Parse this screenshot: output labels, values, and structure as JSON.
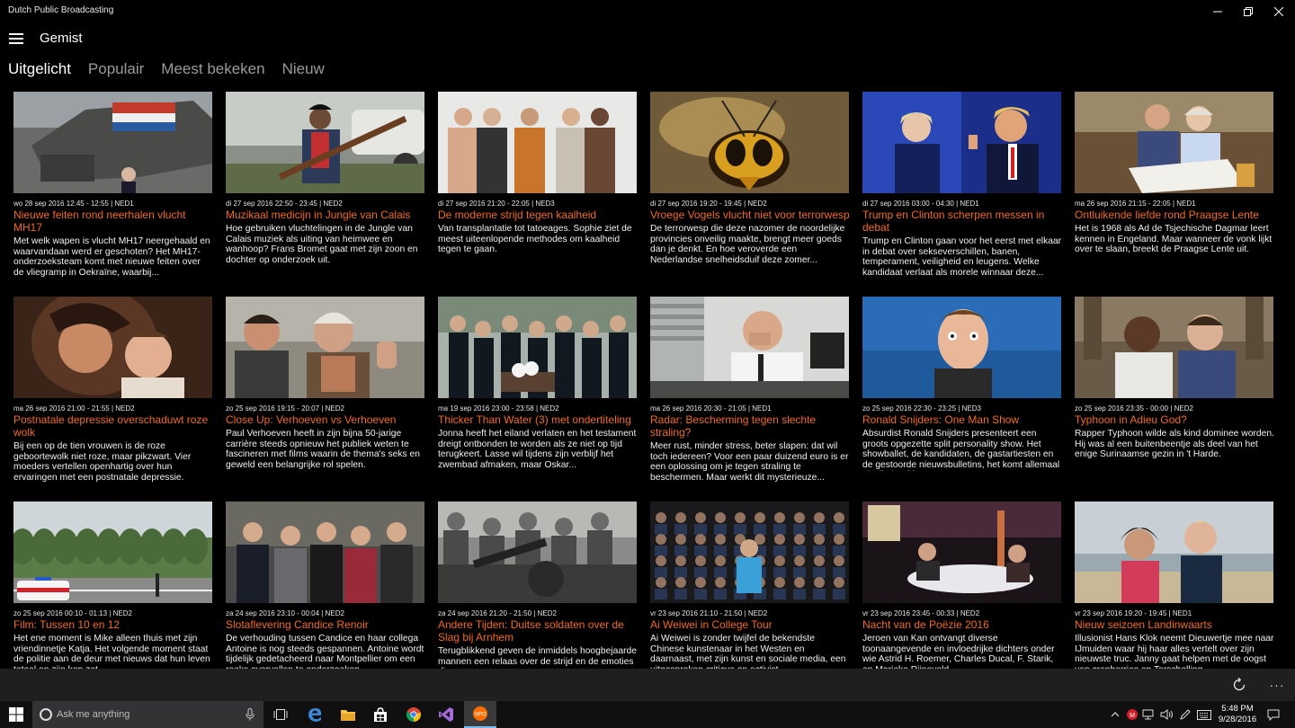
{
  "window": {
    "app_title": "Dutch Public Broadcasting"
  },
  "nav": {
    "page_title": "Gemist"
  },
  "tabs": [
    {
      "label": "Uitgelicht",
      "active": true
    },
    {
      "label": "Populair",
      "active": false
    },
    {
      "label": "Meest bekeken",
      "active": false
    },
    {
      "label": "Nieuw",
      "active": false
    }
  ],
  "cards": [
    {
      "meta": "wo 28 sep 2016 12:45 - 12:55 | NED1",
      "title": "Nieuwe feiten rond neerhalen vlucht MH17",
      "desc": "Met welk wapen is vlucht MH17 neergehaald en waarvandaan werd er geschoten? Het MH17-onderzoeksteam komt met nieuwe feiten over de vliegramp in Oekraïne, waarbij...",
      "image": "aircraft-wreckage"
    },
    {
      "meta": "di 27 sep 2016 22:50 - 23:45 | NED2",
      "title": "Muzikaal medicijn in Jungle van Calais",
      "desc": "Hoe gebruiken vluchtelingen in de Jungle van Calais muziek als uiting van heimwee en wanhoop? Frans Bromet gaat met zijn zoon en dochter op onderzoek uit.",
      "image": "man-with-guitar"
    },
    {
      "meta": "di 27 sep 2016 21:20 - 22:05 | NED3",
      "title": "De moderne strijd tegen kaalheid",
      "desc": "Van transplantatie tot tatoeages. Sophie ziet de meest uiteenlopende methodes om kaalheid tegen te gaan.",
      "image": "group-portrait"
    },
    {
      "meta": "di 27 sep 2016 19:20 - 19:45 | NED2",
      "title": "Vroege Vogels vlucht niet voor terrorwesp",
      "desc": "De terrorwesp die deze nazomer de noordelijke provincies onveilig maakte, brengt meer goeds dan je denkt. En hoe veroverde een Nederlandse snelheidsduif deze zomer...",
      "image": "wasp-closeup"
    },
    {
      "meta": "di 27 sep 2016 03:00 - 04:30 | NED1",
      "title": "Trump en Clinton scherpen messen in debat",
      "desc": "Trump en Clinton gaan voor het eerst met elkaar in debat over sekseverschillen, banen, temperament, veiligheid en leugens. Welke kandidaat verlaat als morele winnaar deze...",
      "image": "debate"
    },
    {
      "meta": "ma 26 sep 2016 21:15 - 22:05 | NED1",
      "title": "Ontluikende liefde rond Praagse Lente",
      "desc": "Het is 1968 als Ad de Tsjechische Dagmar leert kennen in Engeland. Maar wanneer de vonk lijkt over te slaan, breekt de Praagse Lente uit.",
      "image": "couple-with-album"
    },
    {
      "meta": "ma 26 sep 2016 21:00 - 21:55 | NED2",
      "title": "Postnatale depressie overschaduwt roze wolk",
      "desc": "Bij een op de tien vrouwen is de roze geboortewolk niet roze, maar pikzwart. Vier moeders vertellen openhartig over hun ervaringen met een postnatale depressie.",
      "image": "mother-and-baby"
    },
    {
      "meta": "zo 25 sep 2016 19:15 - 20:07 | NED2",
      "title": "Close Up: Verhoeven vs Verhoeven",
      "desc": "Paul Verhoeven heeft in zijn bijna 50-jarige carrière steeds opnieuw het publiek weten te fascineren met films waarin de thema's seks en geweld een belangrijke rol spelen.",
      "image": "two-men-talking"
    },
    {
      "meta": "ma 19 sep 2016 23:00 - 23:58 | NED2",
      "title": "Thicker Than Water (3)  met ondertiteling",
      "desc": "Jonna heeft het eiland verlaten en het testament dreigt ontbonden te worden als ze niet op tijd terugkeert. Lasse wil tijdens zijn verblijf het zwembad afmaken, maar Oskar...",
      "image": "funeral-procession"
    },
    {
      "meta": "ma 26 sep 2016 20:30 - 21:05 | NED1",
      "title": "Radar: Bescherming tegen slechte straling?",
      "desc": "Meer rust, minder stress, beter slapen: dat wil toch iedereen? Voor een paar duizend euro is er een oplossing om je tegen straling te beschermen. Maar werkt dit mysterieuze...",
      "image": "man-at-desk"
    },
    {
      "meta": "zo 25 sep 2016 22:30 - 23:25 | NED3",
      "title": "Ronald Snijders: One Man Show",
      "desc": "Absurdist Ronald Snijders presenteert een groots opgezette split personality show. Het showballet, de kandidaten, de gastartiesten en de gestoorde nieuwsbulletins, het komt allemaal uit zijn hoofd.",
      "image": "comedian-portrait"
    },
    {
      "meta": "zo 25 sep 2016 23:35 - 00:00 | NED2",
      "title": "Typhoon in Adieu God?",
      "desc": "Rapper Typhoon wilde als kind dominee worden. Hij was al een buitenbeentje als deel van het enige Surinaamse gezin in 't Harde.",
      "image": "two-men-in-church"
    },
    {
      "meta": "zo 25 sep 2016 00:10 - 01:13 | NED2",
      "title": "Film: Tussen 10 en 12",
      "desc": "Het ene moment is Mike alleen thuis met zijn vriendinnetje Katja. Het volgende moment staat de politie aan de deur met nieuws dat hun leven totaal op zijn kop zet.",
      "image": "road-with-police-car"
    },
    {
      "meta": "za 24 sep 2016 23:10 - 00:04 | NED2",
      "title": "Slotaflevering Candice Renoir",
      "desc": "De verhouding tussen Candice en haar collega Antoine is nog steeds gespannen. Antoine wordt tijdelijk gedetacheerd naar Montpellier om een reeks overvallen te onderzoeken.",
      "image": "police-team"
    },
    {
      "meta": "za 24 sep 2016 21:20 - 21:50 | NED2",
      "title": "Andere Tijden: Duitse soldaten over de Slag bij Arnhem",
      "desc": "Terugblikkend geven de inmiddels hoogbejaarde mannen een relaas over de strijd en de emoties die ze ervoeren.",
      "image": "ww2-soldiers"
    },
    {
      "meta": "vr 23 sep 2016 21:10 - 21:50 | NED2",
      "title": "Ai Weiwei in College Tour",
      "desc": "Ai Weiwei is zonder twijfel de bekendste Chinese kunstenaar in het Westen en daarnaast, met zijn kunst en sociale media, een uitgesproken criticus en activist.",
      "image": "tv-studio-audience"
    },
    {
      "meta": "vr 23 sep 2016 23:45 - 00:33 | NED2",
      "title": "Nacht van de Poëzie 2016",
      "desc": "Jeroen van Kan ontvangt diverse toonaangevende en invloedrijke dichters onder wie Astrid H. Roemer, Charles Ducal, F. Starik, en Marieke Rijneveld.",
      "image": "talk-show-table"
    },
    {
      "meta": "vr 23 sep 2016 19:20 - 19:45 | NED1",
      "title": "Nieuw seizoen Landinwaarts",
      "desc": "Illusionist Hans Klok neemt Dieuwertje mee naar IJmuiden waar hij haar alles vertelt over zijn nieuwste truc.  Janny gaat helpen met de oogst van cranberries op Terschelling.",
      "image": "two-women-at-beach"
    }
  ],
  "appbar": {
    "refresh_icon": "refresh-icon",
    "more_icon": "more-icon",
    "more_label": "···"
  },
  "taskbar": {
    "search_placeholder": "Ask me anything",
    "time": "5:48 PM",
    "date": "9/28/2016"
  }
}
